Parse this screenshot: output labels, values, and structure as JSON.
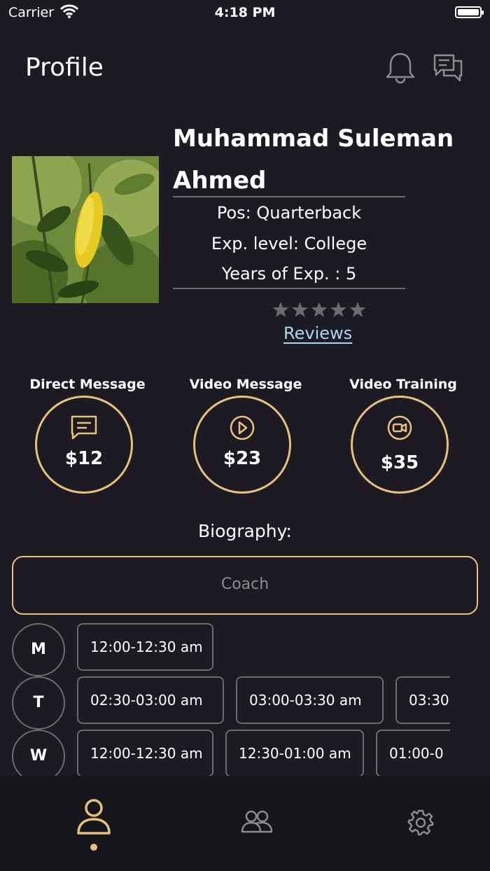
{
  "status": {
    "carrier": "Carrier",
    "time": "4:18 PM"
  },
  "header": {
    "title": "Profile",
    "icons": [
      "bell-icon",
      "chat-icon"
    ]
  },
  "profile": {
    "name": "Muhammad Suleman Ahmed",
    "position": "Pos: Quarterback",
    "exp_level": "Exp. level: College",
    "years": "Years of Exp. : 5",
    "rating": 0,
    "rating_max": 5,
    "reviews_label": "Reviews"
  },
  "services": [
    {
      "label": "Direct Message",
      "price": "$12",
      "icon": "message-icon"
    },
    {
      "label": "Video Message",
      "price": "$23",
      "icon": "play-icon"
    },
    {
      "label": "Video Training",
      "price": "$35",
      "icon": "video-camera-icon"
    }
  ],
  "biography": {
    "label": "Biography:",
    "value": "Coach"
  },
  "schedule": [
    {
      "day": "M",
      "slots": [
        "12:00-12:30 am"
      ]
    },
    {
      "day": "T",
      "slots": [
        "02:30-03:00 am",
        "03:00-03:30 am",
        "03:30"
      ]
    },
    {
      "day": "W",
      "slots": [
        "12:00-12:30 am",
        "12:30-01:00 am",
        "01:00-0"
      ]
    }
  ],
  "tabs": [
    {
      "name": "profile",
      "icon": "user-icon",
      "active": true
    },
    {
      "name": "people",
      "icon": "users-icon",
      "active": false
    },
    {
      "name": "settings",
      "icon": "gear-icon",
      "active": false
    }
  ],
  "colors": {
    "background": "#1d1a23",
    "accent": "#e6c07e",
    "link": "#a9d6f2",
    "tabbar": "#161519"
  }
}
